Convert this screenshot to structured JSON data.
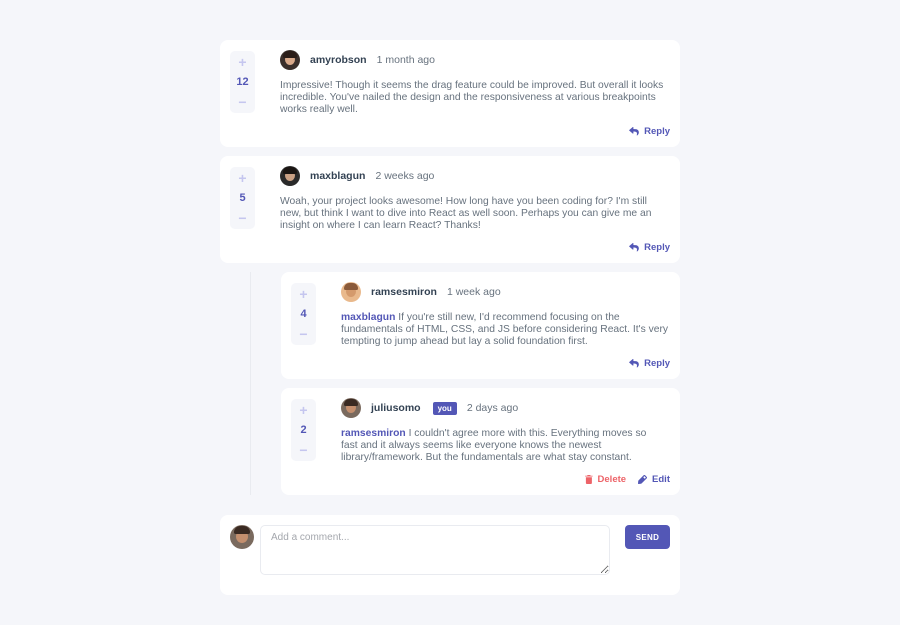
{
  "colors": {
    "accent": "#5357b6",
    "accent_light": "#c5c6ef",
    "danger": "#ed6368",
    "background": "#f5f6fa",
    "text_dark": "#334253",
    "text_body": "#67727e"
  },
  "icons": {
    "reply": "reply-arrow-icon",
    "delete": "trash-icon",
    "edit": "pencil-icon",
    "upvote": "plus-icon",
    "downvote": "minus-icon"
  },
  "labels": {
    "reply": "Reply",
    "delete": "Delete",
    "edit": "Edit",
    "plus": "+",
    "minus": "−",
    "you": "you"
  },
  "comments": [
    {
      "score": "12",
      "username": "amyrobson",
      "date": "1 month ago",
      "content": "Impressive! Though it seems the drag feature could be improved. But overall it looks incredible. You've nailed the design and the responsiveness at various breakpoints works really well."
    },
    {
      "score": "5",
      "username": "maxblagun",
      "date": "2 weeks ago",
      "content": "Woah, your project looks awesome! How long have you been coding for? I'm still new, but think I want to dive into React as well soon. Perhaps you can give me an insight on where I can learn React? Thanks!",
      "replies": [
        {
          "score": "4",
          "username": "ramsesmiron",
          "date": "1 week ago",
          "replying_to": "maxblagun",
          "content": "If you're still new, I'd recommend focusing on the fundamentals of HTML, CSS, and JS before considering React. It's very tempting to jump ahead but lay a solid foundation first."
        },
        {
          "score": "2",
          "username": "juliusomo",
          "date": "2 days ago",
          "replying_to": "ramsesmiron",
          "content": "I couldn't agree more with this. Everything moves so fast and it always seems like everyone knows the newest library/framework. But the fundamentals are what stay constant."
        }
      ]
    }
  ],
  "composer": {
    "placeholder": "Add a comment...",
    "send_label": "SEND"
  }
}
